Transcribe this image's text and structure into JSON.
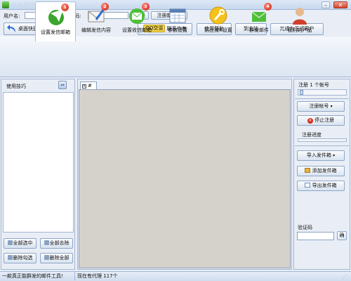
{
  "window": {
    "title": "高尚邮件群发系统"
  },
  "login": {
    "username_label": "用户名:",
    "username_value": "",
    "password_label": "密  码:",
    "password_value": "",
    "login_button": "登录",
    "register_button": "注册新用户"
  },
  "toolbar": {
    "desktop_shortcut": "桌面快捷",
    "qq_button": "QQ交谈",
    "contact_author": "联系作者",
    "help": "使用帮助",
    "home": "到主站",
    "become_customer": "兀成为正式客户"
  },
  "tabs": [
    {
      "label": "设置发信邮箱",
      "badge": "1",
      "icon": "send-mail-icon"
    },
    {
      "label": "编辑发信内容",
      "badge": "2",
      "icon": "edit-mail-icon"
    },
    {
      "label": "设置收信邮箱",
      "badge": "3",
      "icon": "receive-mail-icon"
    },
    {
      "label": "参数设置",
      "badge": "",
      "icon": "calendar-settings-icon"
    },
    {
      "label": "防止被K设置",
      "badge": "",
      "icon": "wrench-icon"
    },
    {
      "label": "群发邮件",
      "badge": "4",
      "icon": "mass-mail-icon"
    },
    {
      "label": "我们的产品",
      "badge": "",
      "icon": "person-icon"
    }
  ],
  "left": {
    "title": "使用技巧",
    "select_all": "全部选中",
    "deselect_all": "全部去除",
    "delete_checked": "删除勾选",
    "delete_all": "删除全部"
  },
  "center": {
    "doc_tab": "#"
  },
  "right": {
    "register_count": "注册 1 个帐号",
    "register_account": "注册帐号",
    "stop_register": "停止注册",
    "register_progress": "注册进度",
    "import_outbox": "导入发件箱",
    "add_outbox": "添加发件箱",
    "export_outbox": "导出发件箱",
    "captcha_label": "验证码",
    "captcha_value": "",
    "confirm": "确"
  },
  "status": {
    "left": "一款真正能群发的邮件工具!",
    "proxy": "现在有代理 117个"
  },
  "colors": {
    "accent": "#2e6bd1",
    "badge": "#d21e0f"
  }
}
